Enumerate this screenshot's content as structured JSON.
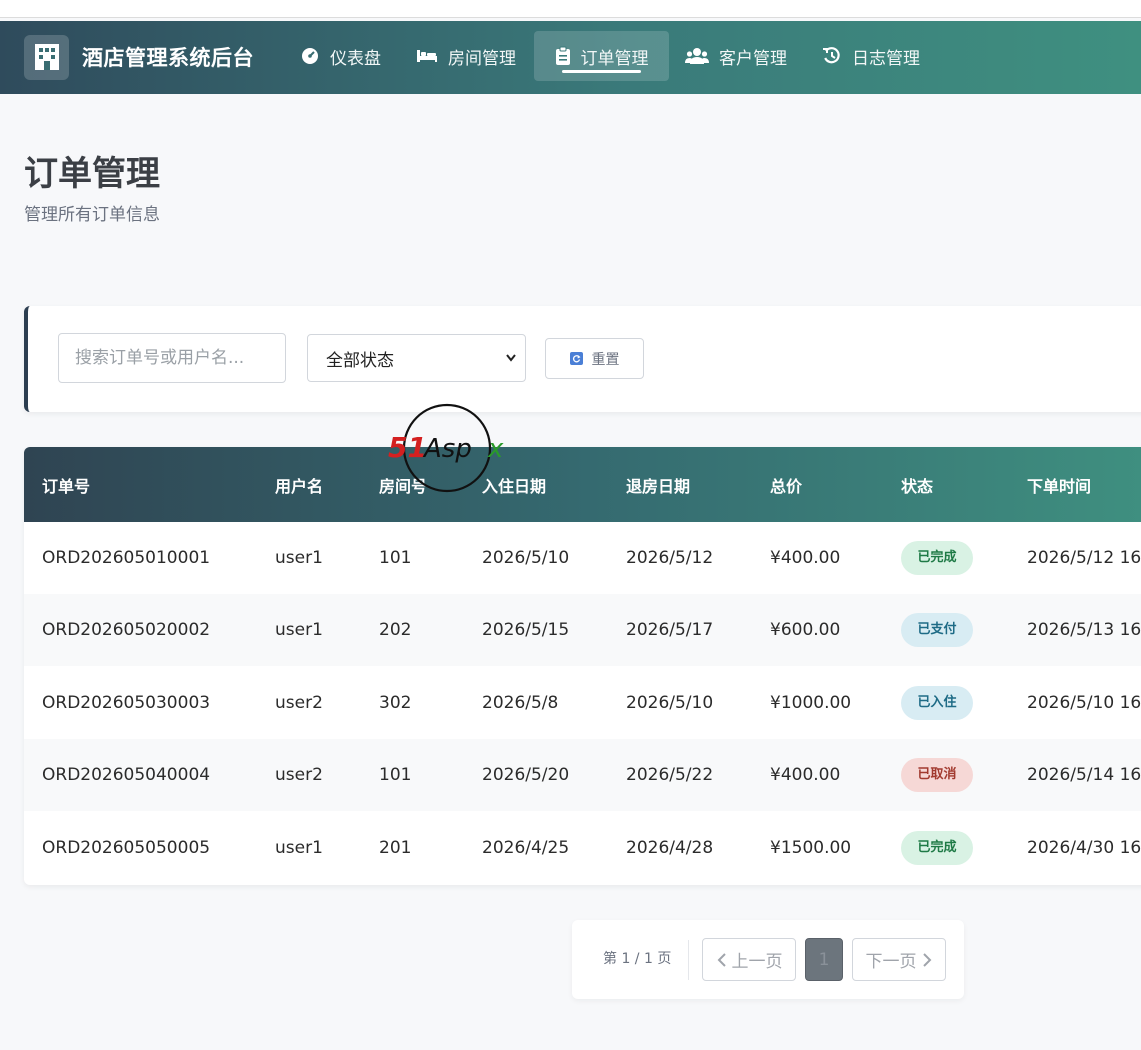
{
  "app": {
    "title": "酒店管理系统后台"
  },
  "nav": {
    "items": [
      {
        "label": "仪表盘",
        "icon": "dashboard-icon"
      },
      {
        "label": "房间管理",
        "icon": "bed-icon"
      },
      {
        "label": "订单管理",
        "icon": "clipboard-icon",
        "active": true
      },
      {
        "label": "客户管理",
        "icon": "users-icon"
      },
      {
        "label": "日志管理",
        "icon": "history-icon"
      }
    ]
  },
  "page": {
    "title": "订单管理",
    "subtitle": "管理所有订单信息"
  },
  "filters": {
    "search_placeholder": "搜索订单号或用户名...",
    "status_value": "全部状态",
    "reset_label": "重置"
  },
  "table": {
    "headers": [
      "订单号",
      "用户名",
      "房间号",
      "入住日期",
      "退房日期",
      "总价",
      "状态",
      "下单时间"
    ],
    "rows": [
      {
        "order_no": "ORD202605010001",
        "user": "user1",
        "room": "101",
        "checkin": "2026/5/10",
        "checkout": "2026/5/12",
        "total": "¥400.00",
        "status": "已完成",
        "created": "2026/5/12 16"
      },
      {
        "order_no": "ORD202605020002",
        "user": "user1",
        "room": "202",
        "checkin": "2026/5/15",
        "checkout": "2026/5/17",
        "total": "¥600.00",
        "status": "已支付",
        "created": "2026/5/13 16"
      },
      {
        "order_no": "ORD202605030003",
        "user": "user2",
        "room": "302",
        "checkin": "2026/5/8",
        "checkout": "2026/5/10",
        "total": "¥1000.00",
        "status": "已入住",
        "created": "2026/5/10 16"
      },
      {
        "order_no": "ORD202605040004",
        "user": "user2",
        "room": "101",
        "checkin": "2026/5/20",
        "checkout": "2026/5/22",
        "total": "¥400.00",
        "status": "已取消",
        "created": "2026/5/14 16"
      },
      {
        "order_no": "ORD202605050005",
        "user": "user1",
        "room": "201",
        "checkin": "2026/4/25",
        "checkout": "2026/4/28",
        "total": "¥1500.00",
        "status": "已完成",
        "created": "2026/4/30 16"
      }
    ]
  },
  "watermark": {
    "text": "51Aspx"
  },
  "pagination": {
    "info": "第 1 / 1 页",
    "prev_label": "上一页",
    "current_page": "1",
    "next_label": "下一页"
  },
  "colors": {
    "status_done": "#1f7a46",
    "status_paid": "#1e6b86",
    "status_checked_in": "#1e6b86",
    "status_cancelled": "#a23a2f",
    "nav_start": "#2f4b5c",
    "nav_end": "#3f9080"
  }
}
